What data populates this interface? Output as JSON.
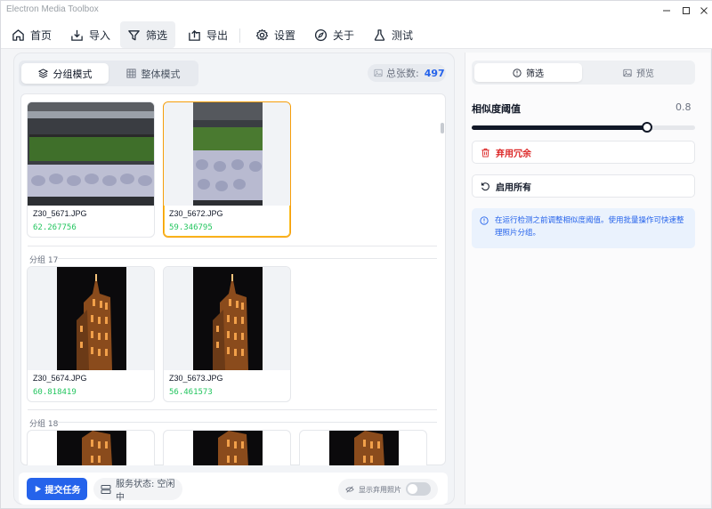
{
  "window": {
    "title": "Electron Media Toolbox"
  },
  "nav": {
    "items": [
      {
        "label": "首页",
        "icon": "home-icon"
      },
      {
        "label": "导入",
        "icon": "import-icon"
      },
      {
        "label": "筛选",
        "icon": "filter-icon",
        "active": true
      },
      {
        "label": "导出",
        "icon": "export-icon"
      },
      {
        "label": "设置",
        "icon": "gear-icon"
      },
      {
        "label": "关于",
        "icon": "compass-icon"
      },
      {
        "label": "测试",
        "icon": "flask-icon"
      }
    ]
  },
  "view_mode": {
    "grouped_label": "分组模式",
    "overall_label": "整体模式",
    "selected": "grouped"
  },
  "total": {
    "label": "总张数:",
    "value": "497"
  },
  "groups": [
    {
      "label": "",
      "photos": [
        {
          "name": "Z30_5671.JPG",
          "score": "62.267756",
          "kind": "tray-wide",
          "selected": false
        },
        {
          "name": "Z30_5672.JPG",
          "score": "59.346795",
          "kind": "tray-tall",
          "selected": true
        }
      ]
    },
    {
      "label": "分组 17",
      "photos": [
        {
          "name": "Z30_5674.JPG",
          "score": "60.818419",
          "kind": "building",
          "selected": false
        },
        {
          "name": "Z30_5673.JPG",
          "score": "56.461573",
          "kind": "building",
          "selected": false
        }
      ]
    },
    {
      "label": "分组 18",
      "photos": [
        {
          "name": "",
          "score": "",
          "kind": "building"
        },
        {
          "name": "",
          "score": "",
          "kind": "building"
        },
        {
          "name": "",
          "score": "",
          "kind": "building"
        }
      ]
    }
  ],
  "bottom": {
    "submit_label": "提交任务",
    "status_label": "服务状态: 空闲中",
    "show_discarded_label": "显示弃用照片",
    "show_discarded": false
  },
  "right": {
    "tabs": [
      {
        "label": "筛选",
        "icon": "info-circle-icon",
        "active": true
      },
      {
        "label": "预览",
        "icon": "image-icon",
        "active": false
      }
    ],
    "similarity": {
      "label": "相似度阈值",
      "value": 0.8,
      "value_text": "0.8"
    },
    "discard_label": "弃用冗余",
    "enable_all_label": "启用所有",
    "info_text": "在运行检测之前调整相似度阈值。使用批量操作可快速整理照片分组。"
  },
  "colors": {
    "accent": "#2563eb",
    "score_green": "#22c55e",
    "danger": "#dc2626",
    "selected_border": "#f59e0b"
  }
}
